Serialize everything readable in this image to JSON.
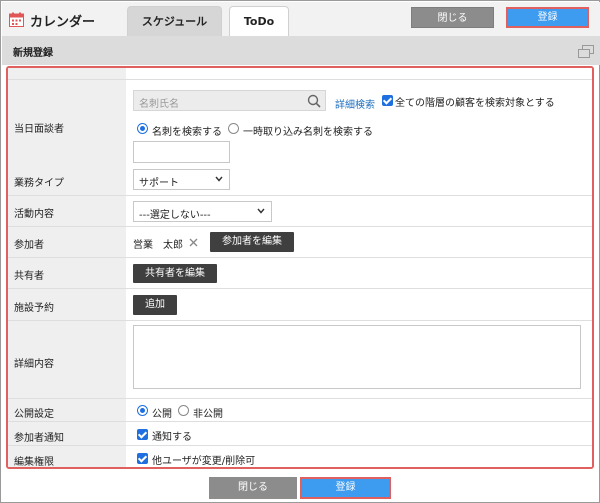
{
  "header": {
    "app_title": "カレンダー",
    "tabs": [
      "スケジュール",
      "ToDo"
    ],
    "close_label": "閉じる",
    "save_label": "登録"
  },
  "section": {
    "title": "新規登録"
  },
  "form": {
    "interviewee": {
      "label": "当日面談者",
      "search_placeholder": "名刺氏名",
      "detail_search": "詳細検索",
      "all_levels": "全ての階層の顧客を検索対象とする",
      "radio_card": "名刺を検索する",
      "radio_temp": "一時取り込み名刺を検索する"
    },
    "business_type": {
      "label": "業務タイプ",
      "value": "サポート"
    },
    "activity": {
      "label": "活動内容",
      "value": "---選定しない---"
    },
    "participants": {
      "label": "参加者",
      "name": "営業　太郎",
      "edit_button": "参加者を編集"
    },
    "sharers": {
      "label": "共有者",
      "edit_button": "共有者を編集"
    },
    "facility": {
      "label": "施設予約",
      "add_button": "追加"
    },
    "details": {
      "label": "詳細内容",
      "value": ""
    },
    "visibility": {
      "label": "公開設定",
      "public": "公開",
      "private": "非公開"
    },
    "notify": {
      "label": "参加者通知",
      "option": "通知する"
    },
    "edit_permission": {
      "label": "編集権限",
      "option": "他ユーザが変更/削除可"
    }
  },
  "footer": {
    "close_label": "閉じる",
    "save_label": "登録"
  },
  "icons": [
    "calendar-icon",
    "search-icon",
    "close-icon",
    "chevron-down-icon",
    "window-icon"
  ],
  "colors": {
    "accent": "#3d9bf0",
    "highlight_border": "#e06060",
    "dark_button": "#3f3f3f",
    "link": "#1f6fc0"
  }
}
